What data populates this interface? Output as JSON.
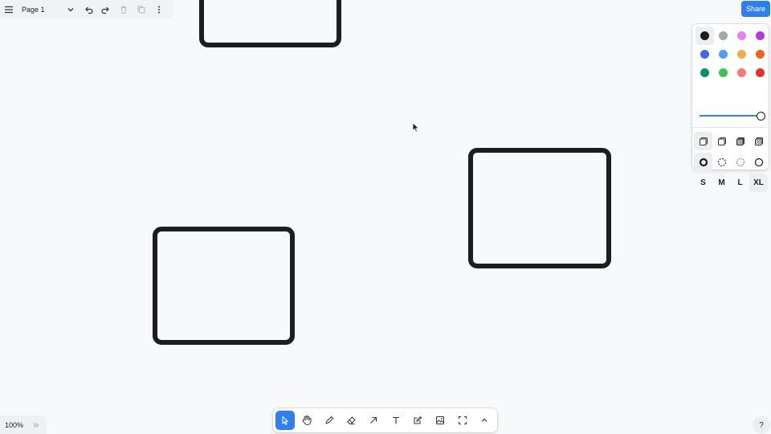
{
  "menu": {
    "page_name": "Page 1",
    "icons": [
      "hamburger-menu-icon",
      "chevron-down-icon",
      "undo-icon",
      "redo-icon",
      "trash-icon",
      "duplicate-icon",
      "more-vertical-icon"
    ]
  },
  "share": {
    "label": "Share",
    "color": "#2f80ed"
  },
  "style_panel": {
    "colors": [
      {
        "name": "black",
        "hex": "#1d1d1d",
        "selected": true
      },
      {
        "name": "grey",
        "hex": "#a3a6ab"
      },
      {
        "name": "light-violet",
        "hex": "#e284f0"
      },
      {
        "name": "violet",
        "hex": "#ad3dd6"
      },
      {
        "name": "blue",
        "hex": "#4465e9"
      },
      {
        "name": "light-blue",
        "hex": "#4ba1f1"
      },
      {
        "name": "yellow",
        "hex": "#f1ac4b"
      },
      {
        "name": "orange",
        "hex": "#f0651a"
      },
      {
        "name": "green",
        "hex": "#099268"
      },
      {
        "name": "light-green",
        "hex": "#40c057"
      },
      {
        "name": "light-red",
        "hex": "#f87777"
      },
      {
        "name": "red",
        "hex": "#e03131"
      }
    ],
    "opacity": 1.0,
    "fill_icons": [
      "fill-none-icon",
      "fill-semi-icon",
      "fill-solid-icon",
      "fill-pattern-icon"
    ],
    "dash_icons": [
      "dash-draw-icon",
      "dash-dashed-icon",
      "dash-dotted-icon",
      "dash-solid-icon"
    ],
    "sizes": [
      "S",
      "M",
      "L",
      "XL"
    ],
    "selected_size": "XL"
  },
  "toolbar": {
    "tools": [
      "select-icon",
      "hand-icon",
      "draw-icon",
      "eraser-icon",
      "arrow-icon",
      "text-icon",
      "note-icon",
      "image-icon",
      "frame-icon",
      "chevron-up-icon"
    ],
    "active": "select"
  },
  "zoom": {
    "label": "100%"
  },
  "help": {
    "label": "?"
  }
}
